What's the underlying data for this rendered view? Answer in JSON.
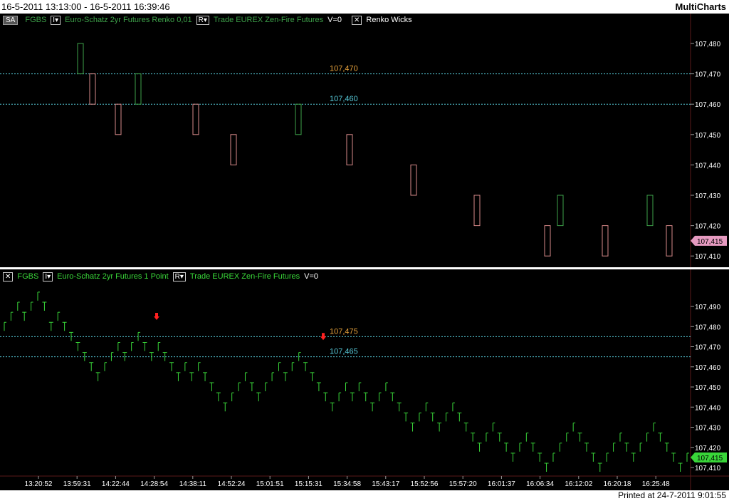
{
  "window": {
    "date_range": "16-5-2011 13:13:00 - 16-5-2011 16:39:46",
    "app_name": "MultiCharts"
  },
  "top_pane": {
    "header": {
      "sa_button": "SA",
      "symbol": "FGBS",
      "description": "Euro-Schatz 2yr Futures  Renko 0,01",
      "data_type": "Trade  EUREX  Zen-Fire  Futures",
      "volume": "V=0",
      "indicator": "Renko Wicks"
    },
    "levels": [
      {
        "label": "107,470",
        "value": 107.47,
        "color": "#e8a33c"
      },
      {
        "label": "107,460",
        "value": 107.46,
        "color": "#57c9d8"
      }
    ],
    "price_ticks": [
      "107,480",
      "107,470",
      "107,460",
      "107,450",
      "107,440",
      "107,430",
      "107,420",
      "107,410"
    ],
    "current_price": "107,415"
  },
  "bottom_pane": {
    "header": {
      "symbol": "FGBS",
      "description": "Euro-Schatz 2yr Futures  1 Point",
      "data_type": "Trade  EUREX  Zen-Fire  Futures",
      "volume": "V=0"
    },
    "levels": [
      {
        "label": "107,475",
        "value": 107.475,
        "color": "#e8a33c"
      },
      {
        "label": "107,465",
        "value": 107.465,
        "color": "#57c9d8"
      }
    ],
    "price_ticks": [
      "107,490",
      "107,480",
      "107,470",
      "107,460",
      "107,450",
      "107,440",
      "107,430",
      "107,420",
      "107,410"
    ],
    "current_price": "107,415"
  },
  "time_axis": [
    "13:20:52",
    "13:59:31",
    "14:22:44",
    "14:28:54",
    "14:38:11",
    "14:52:24",
    "15:01:51",
    "15:15:31",
    "15:34:58",
    "15:43:17",
    "15:52:56",
    "15:57:20",
    "16:01:37",
    "16:06:34",
    "16:12:02",
    "16:20:18",
    "16:25:48"
  ],
  "footer": {
    "printed": "Printed at 24-7-2011 9:01:55"
  },
  "colors": {
    "up": "#3ea24a",
    "down": "#d98a8a",
    "point": "#39d639",
    "grid": "#5a1a1a",
    "axis_text": "#ffffff"
  },
  "chart_data": [
    {
      "type": "renko",
      "title": "FGBS Euro-Schatz 2yr Futures Renko 0,01",
      "ylim": [
        107.405,
        107.488
      ],
      "bricks": [
        {
          "dir": "up",
          "low": 107.47,
          "high": 107.48
        },
        {
          "dir": "down",
          "low": 107.46,
          "high": 107.47
        },
        {
          "dir": "down",
          "low": 107.45,
          "high": 107.46
        },
        {
          "dir": "up",
          "low": 107.46,
          "high": 107.47
        },
        {
          "dir": "down",
          "low": 107.45,
          "high": 107.46
        },
        {
          "dir": "down",
          "low": 107.44,
          "high": 107.45
        },
        {
          "dir": "up",
          "low": 107.45,
          "high": 107.46
        },
        {
          "dir": "down",
          "low": 107.44,
          "high": 107.45
        },
        {
          "dir": "down",
          "low": 107.43,
          "high": 107.44
        },
        {
          "dir": "down",
          "low": 107.42,
          "high": 107.43
        },
        {
          "dir": "down",
          "low": 107.41,
          "high": 107.42
        },
        {
          "dir": "up",
          "low": 107.42,
          "high": 107.43
        },
        {
          "dir": "down",
          "low": 107.41,
          "high": 107.42
        },
        {
          "dir": "up",
          "low": 107.42,
          "high": 107.43
        },
        {
          "dir": "down",
          "low": 107.41,
          "high": 107.42
        }
      ]
    },
    {
      "type": "point",
      "title": "FGBS Euro-Schatz 2yr Futures 1 Point",
      "ylim": [
        107.405,
        107.5
      ],
      "values": [
        107.48,
        107.485,
        107.49,
        107.485,
        107.49,
        107.495,
        107.49,
        107.48,
        107.485,
        107.48,
        107.475,
        107.47,
        107.465,
        107.46,
        107.455,
        107.46,
        107.465,
        107.47,
        107.465,
        107.47,
        107.475,
        107.47,
        107.465,
        107.47,
        107.465,
        107.46,
        107.455,
        107.46,
        107.455,
        107.46,
        107.455,
        107.45,
        107.445,
        107.44,
        107.445,
        107.45,
        107.455,
        107.45,
        107.445,
        107.45,
        107.455,
        107.46,
        107.455,
        107.46,
        107.465,
        107.46,
        107.455,
        107.45,
        107.445,
        107.44,
        107.445,
        107.45,
        107.445,
        107.45,
        107.445,
        107.44,
        107.445,
        107.45,
        107.445,
        107.44,
        107.435,
        107.43,
        107.435,
        107.44,
        107.435,
        107.43,
        107.435,
        107.44,
        107.435,
        107.43,
        107.425,
        107.42,
        107.425,
        107.43,
        107.425,
        107.42,
        107.415,
        107.42,
        107.425,
        107.42,
        107.415,
        107.41,
        107.415,
        107.42,
        107.425,
        107.43,
        107.425,
        107.42,
        107.415,
        107.41,
        107.415,
        107.42,
        107.425,
        107.42,
        107.415,
        107.42,
        107.425,
        107.43,
        107.425,
        107.42,
        107.415,
        107.41,
        107.415
      ]
    }
  ]
}
